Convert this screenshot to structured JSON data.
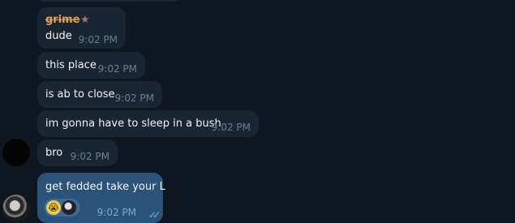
{
  "messages": [
    {
      "sender": "grime",
      "text": "dude",
      "time": "9:02 PM"
    },
    {
      "text": "this place",
      "time": "9:02 PM"
    },
    {
      "text": "is ab to close",
      "time": "9:02 PM"
    },
    {
      "text": "im gonna have to sleep in a bush",
      "time": "9:02 PM"
    },
    {
      "text": "bro",
      "time": "9:02 PM"
    }
  ],
  "reply": {
    "text": "get fedded take your L",
    "time": "9:02 PM",
    "reaction_emoji": "😭",
    "read_checks": "✓✓"
  },
  "icons": {
    "admin": "star-icon",
    "read": "double-check-icon"
  },
  "colors": {
    "background": "#0e1621",
    "incoming_bubble": "#182533",
    "outgoing_bubble": "#2b5278",
    "sender_name": "#e4a055",
    "time": "#6d7f8f"
  }
}
